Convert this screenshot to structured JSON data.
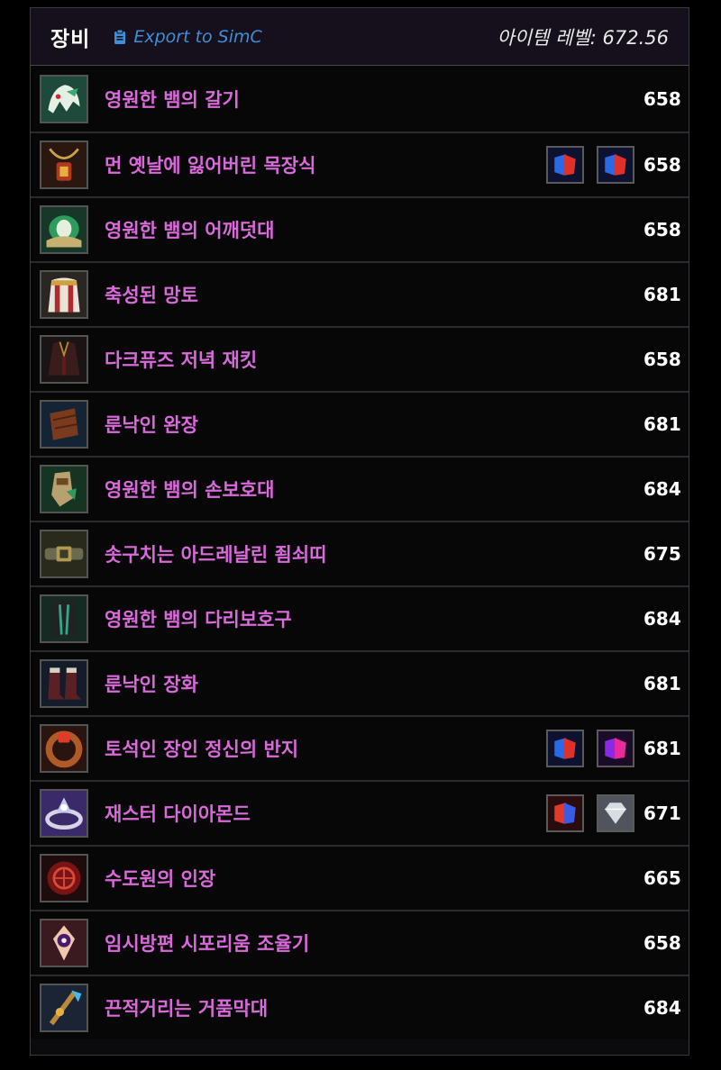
{
  "header": {
    "title": "장비",
    "export_label": "Export to SimC",
    "item_level_text": "아이템 레벨: 672.56"
  },
  "colors": {
    "item_name": "#d86ad9",
    "export_link": "#3e8fd8",
    "background": "#000000"
  },
  "items": [
    {
      "name": "영원한 뱀의 갈기",
      "ilvl": "658",
      "icon": "serpent-helm-icon",
      "gems": []
    },
    {
      "name": "먼 옛날에 잃어버린 목장식",
      "ilvl": "658",
      "icon": "necklace-icon",
      "gems": [
        "blue-red-gem",
        "blue-red-gem"
      ]
    },
    {
      "name": "영원한 뱀의 어깨덧대",
      "ilvl": "658",
      "icon": "serpent-shoulders-icon",
      "gems": []
    },
    {
      "name": "축성된 망토",
      "ilvl": "681",
      "icon": "cloak-icon",
      "gems": []
    },
    {
      "name": "다크퓨즈 저녁 재킷",
      "ilvl": "658",
      "icon": "jacket-icon",
      "gems": []
    },
    {
      "name": "룬낙인 완장",
      "ilvl": "681",
      "icon": "bracer-icon",
      "gems": []
    },
    {
      "name": "영원한 뱀의 손보호대",
      "ilvl": "684",
      "icon": "serpent-gloves-icon",
      "gems": []
    },
    {
      "name": "솟구치는 아드레날린 죔쇠띠",
      "ilvl": "675",
      "icon": "belt-icon",
      "gems": []
    },
    {
      "name": "영원한 뱀의 다리보호구",
      "ilvl": "684",
      "icon": "serpent-legs-icon",
      "gems": []
    },
    {
      "name": "룬낙인 장화",
      "ilvl": "681",
      "icon": "boots-icon",
      "gems": []
    },
    {
      "name": "토석인 장인 정신의 반지",
      "ilvl": "681",
      "icon": "ring-icon",
      "gems": [
        "blue-red-gem",
        "pink-blue-gem"
      ]
    },
    {
      "name": "재스터 다이아몬드",
      "ilvl": "671",
      "icon": "diamond-ring-icon",
      "gems": [
        "red-blue-gem",
        "white-diamond-gem"
      ]
    },
    {
      "name": "수도원의 인장",
      "ilvl": "665",
      "icon": "seal-icon",
      "gems": []
    },
    {
      "name": "임시방편 시포리움 조율기",
      "ilvl": "658",
      "icon": "ciborium-icon",
      "gems": []
    },
    {
      "name": "끈적거리는 거품막대",
      "ilvl": "684",
      "icon": "staff-icon",
      "gems": []
    }
  ]
}
